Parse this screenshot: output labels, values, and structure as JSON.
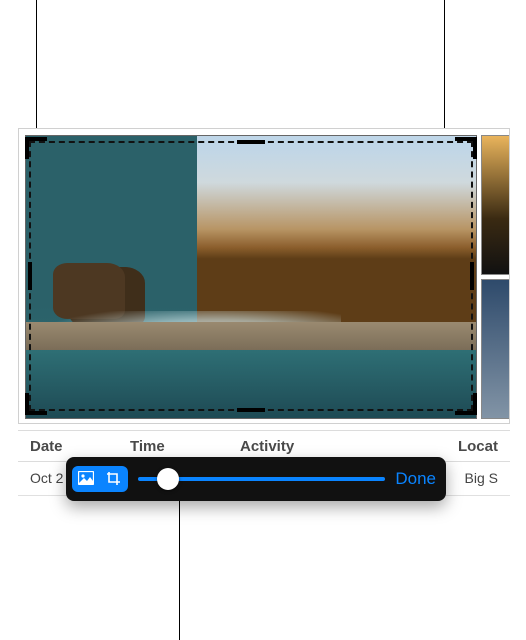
{
  "headers": {
    "date": "Date",
    "time": "Time",
    "activity": "Activity",
    "location": "Locat"
  },
  "rows": [
    {
      "date": "Oct 2",
      "time": "",
      "activity": "",
      "location": "Big S"
    }
  ],
  "toolbar": {
    "mode": "crop",
    "slider_value": 0.12,
    "done_label": "Done"
  },
  "icons": {
    "photo": "photo-icon",
    "crop": "crop-icon"
  },
  "colors": {
    "accent": "#0a84ff",
    "toolbar_bg": "#111111"
  }
}
